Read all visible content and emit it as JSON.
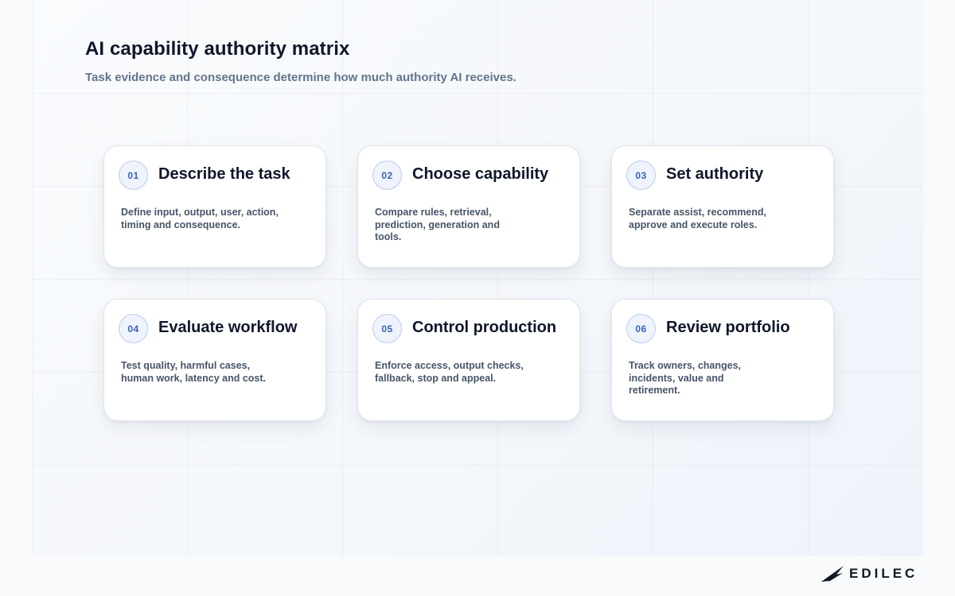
{
  "header": {
    "title": "AI capability authority matrix",
    "subtitle": "Task evidence and consequence determine how much authority AI receives."
  },
  "steps": [
    {
      "number": "01",
      "title": "Describe the task",
      "description": "Define input, output, user, action, timing and consequence."
    },
    {
      "number": "02",
      "title": "Choose capability",
      "description": "Compare rules, retrieval, prediction, generation and tools."
    },
    {
      "number": "03",
      "title": "Set authority",
      "description": "Separate assist, recommend, approve and execute roles."
    },
    {
      "number": "04",
      "title": "Evaluate workflow",
      "description": "Test quality, harmful cases, human work, latency and cost."
    },
    {
      "number": "05",
      "title": "Control production",
      "description": "Enforce access, output checks, fallback, stop and appeal."
    },
    {
      "number": "06",
      "title": "Review portfolio",
      "description": "Track owners, changes, incidents, value and retirement."
    }
  ],
  "brand": {
    "logo_text": "EDILEC",
    "logo_icon": "wing-icon"
  },
  "colors": {
    "title": "#0f172a",
    "subtitle": "#64748b",
    "badge_text": "#3b63b3",
    "badge_border": "#b9cdf0",
    "badge_fill": "#eef3fc",
    "card_bg": "#ffffff"
  }
}
